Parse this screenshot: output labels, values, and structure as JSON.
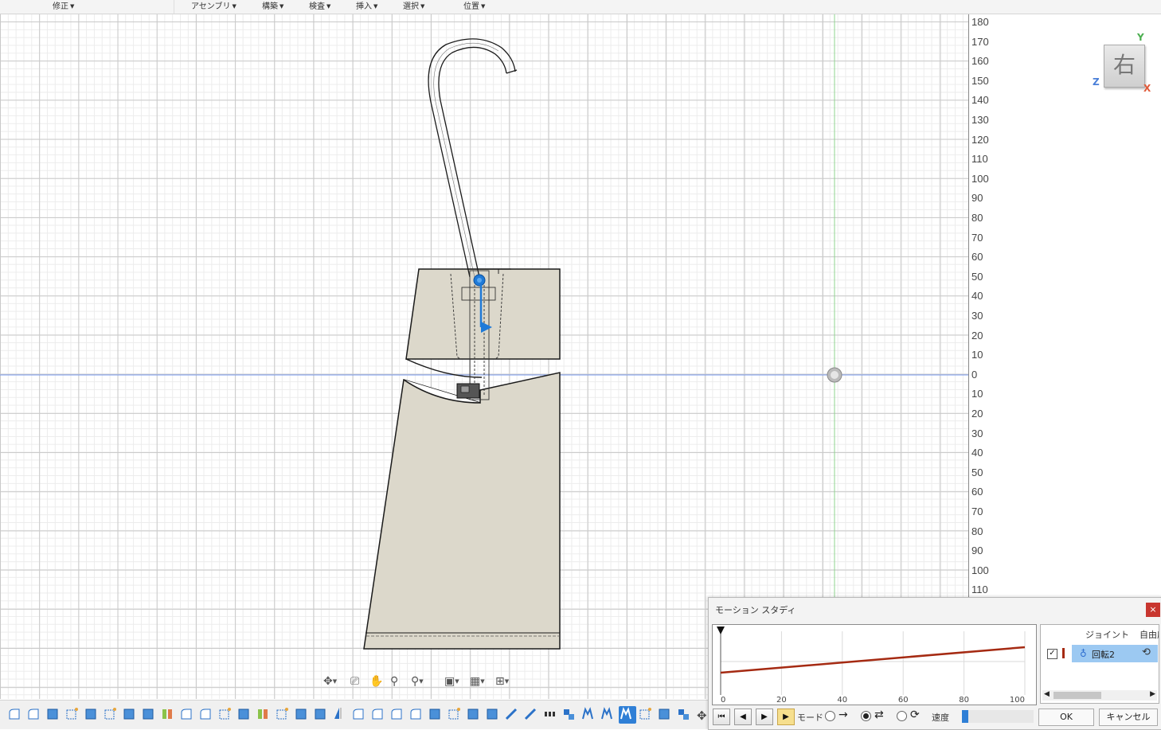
{
  "menu": {
    "items": [
      {
        "label": "修正"
      },
      {
        "label": "アセンブリ"
      },
      {
        "label": "構築"
      },
      {
        "label": "検査"
      },
      {
        "label": "挿入"
      },
      {
        "label": "選択"
      },
      {
        "label": "位置"
      }
    ]
  },
  "ruler": {
    "ticks": [
      "180",
      "170",
      "160",
      "150",
      "140",
      "130",
      "120",
      "110",
      "100",
      "90",
      "80",
      "70",
      "60",
      "50",
      "40",
      "30",
      "20",
      "10",
      "0",
      "10",
      "20",
      "30",
      "40",
      "50",
      "60",
      "70",
      "80",
      "90",
      "100",
      "110"
    ]
  },
  "viewcube": {
    "face_label": "右",
    "axis_y": "Y",
    "axis_z": "Z",
    "axis_x": "X"
  },
  "motion_study": {
    "title": "モーション スタディ",
    "close_label": "×",
    "graph": {
      "x_ticks": [
        "0",
        "20",
        "40",
        "60",
        "80",
        "100"
      ],
      "line_color": "#a52a12",
      "start_value": 0.35,
      "end_value": 0.75
    },
    "table": {
      "header_joint": "ジョイント",
      "header_dof": "自由度",
      "row": {
        "checked": "✓",
        "name": "回転2"
      }
    },
    "controls": {
      "mode_label": "モード",
      "speed_label": "速度",
      "speed_value": 0.0,
      "ok_label": "OK",
      "cancel_label": "キャンセル"
    }
  },
  "colors": {
    "accent": "#2f7fd6",
    "model_fill": "#dcd8cb",
    "joint_blue": "#1f7ad8"
  }
}
